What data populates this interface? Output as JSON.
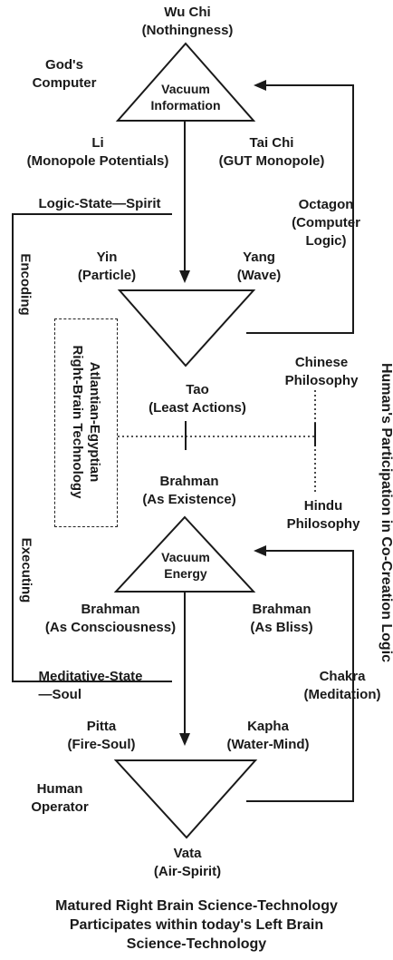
{
  "top": {
    "line1": "Wu Chi",
    "line2": "(Nothingness)"
  },
  "gods_computer": {
    "line1": "God's",
    "line2": "Computer"
  },
  "vacuum_information": {
    "line1": "Vacuum",
    "line2": "Information"
  },
  "li": {
    "line1": "Li",
    "line2": "(Monopole Potentials)"
  },
  "tai_chi": {
    "line1": "Tai Chi",
    "line2": "(GUT Monopole)"
  },
  "logic_state": "Logic-State—Spirit",
  "octagon": {
    "line1": "Octagon",
    "line2": "(Computer",
    "line3": "Logic)"
  },
  "encoding": "Encoding",
  "yin": {
    "line1": "Yin",
    "line2": "(Particle)"
  },
  "yang": {
    "line1": "Yang",
    "line2": "(Wave)"
  },
  "atlantian": {
    "line1": "Atlantian-Egyptian",
    "line2": "Right-Brain Technology"
  },
  "chinese": {
    "line1": "Chinese",
    "line2": "Philosophy"
  },
  "tao": {
    "line1": "Tao",
    "line2": "(Least Actions)"
  },
  "brahman_existence": {
    "line1": "Brahman",
    "line2": "(As Existence)"
  },
  "hindu": {
    "line1": "Hindu",
    "line2": "Philosophy"
  },
  "vacuum_energy": {
    "line1": "Vacuum",
    "line2": "Energy"
  },
  "executing": "Executing",
  "brahman_consciousness": {
    "line1": "Brahman",
    "line2": "(As Consciousness)"
  },
  "brahman_bliss": {
    "line1": "Brahman",
    "line2": "(As Bliss)"
  },
  "meditative_state": {
    "line1": "Meditative-State",
    "line2": "—Soul"
  },
  "chakra": {
    "line1": "Chakra",
    "line2": "(Meditation)"
  },
  "pitta": {
    "line1": "Pitta",
    "line2": "(Fire-Soul)"
  },
  "kapha": {
    "line1": "Kapha",
    "line2": "(Water-Mind)"
  },
  "human_operator": {
    "line1": "Human",
    "line2": "Operator"
  },
  "vata": {
    "line1": "Vata",
    "line2": "(Air-Spirit)"
  },
  "human_participation": "Human's Participation in Co-Creation Logic",
  "caption": {
    "line1": "Matured Right Brain Science-Technology",
    "line2": "Participates within today's Left Brain",
    "line3": "Science-Technology"
  }
}
